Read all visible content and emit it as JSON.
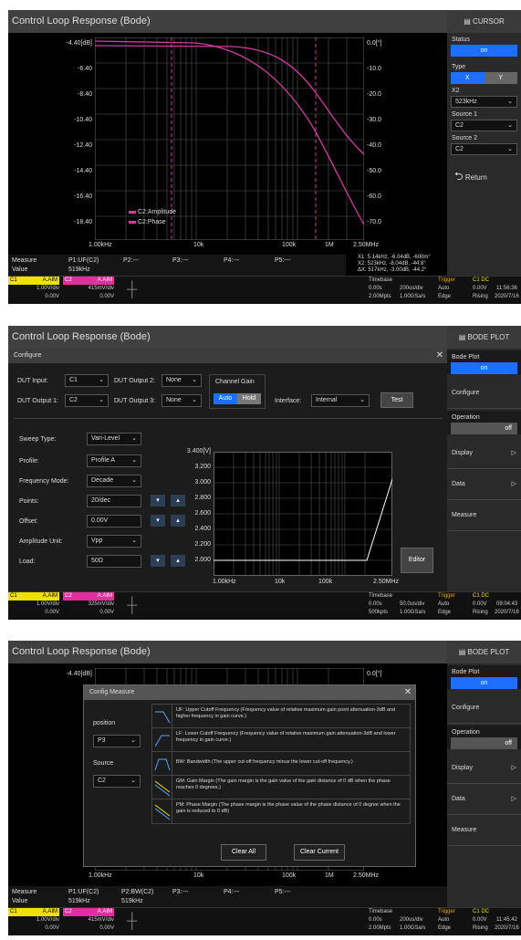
{
  "s1": {
    "title": "Control Loop Response (Bode)",
    "side": {
      "header": "CURSOR",
      "status_label": "Status",
      "status_value": "on",
      "type_label": "Type",
      "type_x": "X",
      "type_y": "Y",
      "x2_label": "X2",
      "x2_value": "523kHz",
      "src1_label": "Source 1",
      "src1_value": "C2",
      "src2_label": "Source 2",
      "src2_value": "C2",
      "return_label": "Return"
    },
    "yleft": [
      "-4.40[dB]",
      "-6.40",
      "-8.40",
      "-10.40",
      "-12.40",
      "-14.40",
      "-16.40",
      "-18.40"
    ],
    "yright": [
      "0.0[°]",
      "-10.0",
      "-20.0",
      "-30.0",
      "-40.0",
      "-50.0",
      "-60.0",
      "-70.0"
    ],
    "xticks": [
      "1.00kHz",
      "10k",
      "100k",
      "1M",
      "2.50MHz"
    ],
    "legend": [
      "C2:Amplitude",
      "C2:Phase"
    ],
    "cursor": [
      "X1: 5.14kHz, -6.04dB, -600m°",
      "X2: 523kHz, -8.04dB, -44.8°",
      "ΔX: 517kHz, -3.00dB, -44.2°"
    ],
    "measure": {
      "label": "Measure",
      "value_label": "Value",
      "p1": "P1:UF(C2)",
      "p2": "P2:---",
      "p3": "P3:---",
      "p4": "P4:---",
      "p5": "P5:---",
      "v1": "519kHz"
    },
    "status": {
      "c1": "C1",
      "c2": "C2",
      "aaim": "A.AIM",
      "c1v": "1.00V/div",
      "c1o": "0.00V",
      "c2v": "415mV/div",
      "c2o": "0.00V",
      "x1": "1X",
      "x2": "1X",
      "tb_label": "Timebase",
      "tb1": "0.00s",
      "tb2": "200us/div",
      "tb3": "2.00Mpts",
      "tb4": "1.00GSa/s",
      "tr_label": "Trigger",
      "tr1": "Auto",
      "tr2": "Edge",
      "trc": "C1 DC",
      "tr3": "0.00V",
      "tr4": "Rising",
      "time": "11:56:36",
      "date": "2020/7/16"
    }
  },
  "s2": {
    "title": "Control Loop Response (Bode)",
    "side": {
      "header": "BODE PLOT",
      "bode_label": "Bode Plot",
      "bode_value": "on",
      "configure": "Configure",
      "operation": "Operation",
      "op_value": "off",
      "display": "Display",
      "data": "Data",
      "measure": "Measure"
    },
    "dialog": {
      "title": "Configure",
      "dut_input": "DUT Input:",
      "dut_input_v": "C1",
      "dut_out2": "DUT Output 2:",
      "dut_out2_v": "None",
      "dut_out1": "DUT Output 1:",
      "dut_out1_v": "C2",
      "dut_out3": "DUT Output 3:",
      "dut_out3_v": "None",
      "chgain": "Channel Gain",
      "auto": "Auto",
      "hold": "Hold",
      "interface": "Interface:",
      "interface_v": "Internal",
      "test": "Test",
      "sweep": "Sweep Type:",
      "sweep_v": "Vari-Level",
      "profile": "Profile:",
      "profile_v": "Profile A",
      "freqmode": "Frequency Mode:",
      "freqmode_v": "Decade",
      "points": "Points:",
      "points_v": "20/dec",
      "offset": "Offset:",
      "offset_v": "0.00V",
      "ampunit": "Amplitude Unit:",
      "ampunit_v": "Vpp",
      "load": "Load:",
      "load_v": "50Ω",
      "editor": "Editor",
      "yticks": [
        "3.400[V]",
        "3.200",
        "3.000",
        "2.800",
        "2.600",
        "2.400",
        "2.200",
        "2.000"
      ],
      "xticks": [
        "1.00kHz",
        "10k",
        "100k",
        "2.50MHz"
      ]
    },
    "status": {
      "c1v": "1.00V/div",
      "c1o": "0.00V",
      "c2v": "325mV/div",
      "c2o": "0.00V",
      "tb1": "0.00s",
      "tb2": "50.0us/div",
      "tb3": "500kpts",
      "tb4": "1.00GSa/s",
      "tr1": "Auto",
      "tr2": "Edge",
      "trc": "C1 DC",
      "tr3": "0.00V",
      "tr4": "Rising",
      "time": "09:04:43",
      "date": "2020/7/16"
    }
  },
  "s3": {
    "title": "Control Loop Response (Bode)",
    "side": {
      "header": "BODE PLOT",
      "bode_label": "Bode Plot",
      "bode_value": "on",
      "configure": "Configure",
      "operation": "Operation",
      "op_value": "off",
      "display": "Display",
      "data": "Data",
      "measure": "Measure"
    },
    "yleft": "-4.40[dB]",
    "yright": "0.0[°]",
    "xticks": [
      "1.00kHz",
      "10k",
      "100k",
      "1M",
      "2.50MHz"
    ],
    "dialog": {
      "title": "Config Measure",
      "position": "position",
      "position_v": "P3",
      "source": "Source",
      "source_v": "C2",
      "items": [
        "UF: Upper Cutoff Frequency (Frequency value of relative maximum gain point attenuation-3dB and higher frequency in gain curve.)",
        "LF: Lower Cutoff Frequency (Frequency value of relative maximum gain attenuation-3dB and lower frequency in gain curve.)",
        "BW: Bandwidth (The upper cut-off frequency minus the lower cut-off frequency.)",
        "GM: Gain Margin (The gain margin is the gain value of the gain distance of 0 dB when the phase reaches 0 degrees.)",
        "PM: Phase Margin (The phase margin is the phase value of the phase distance of 0 degree when the gain is reduced to 0 dB)"
      ],
      "clear_all": "Clear All",
      "clear_current": "Clear Current"
    },
    "measure": {
      "label": "Measure",
      "value_label": "Value",
      "p1": "P1:UF(C2)",
      "p2": "P2:BW(C2)",
      "p3": "P3:---",
      "p4": "P4:---",
      "p5": "P5:---",
      "v1": "519kHz",
      "v2": "519kHz"
    },
    "status": {
      "c1v": "1.00V/div",
      "c1o": "0.00V",
      "c2v": "415mV/div",
      "c2o": "0.00V",
      "tb1": "0.00s",
      "tb2": "200us/div",
      "tb3": "2.00Mpts",
      "tb4": "1.00GSa/s",
      "tr1": "Auto",
      "tr2": "Edge",
      "trc": "C1 DC",
      "tr3": "0.00V",
      "tr4": "Rising",
      "time": "11:45:42",
      "date": "2020/7/16"
    }
  }
}
